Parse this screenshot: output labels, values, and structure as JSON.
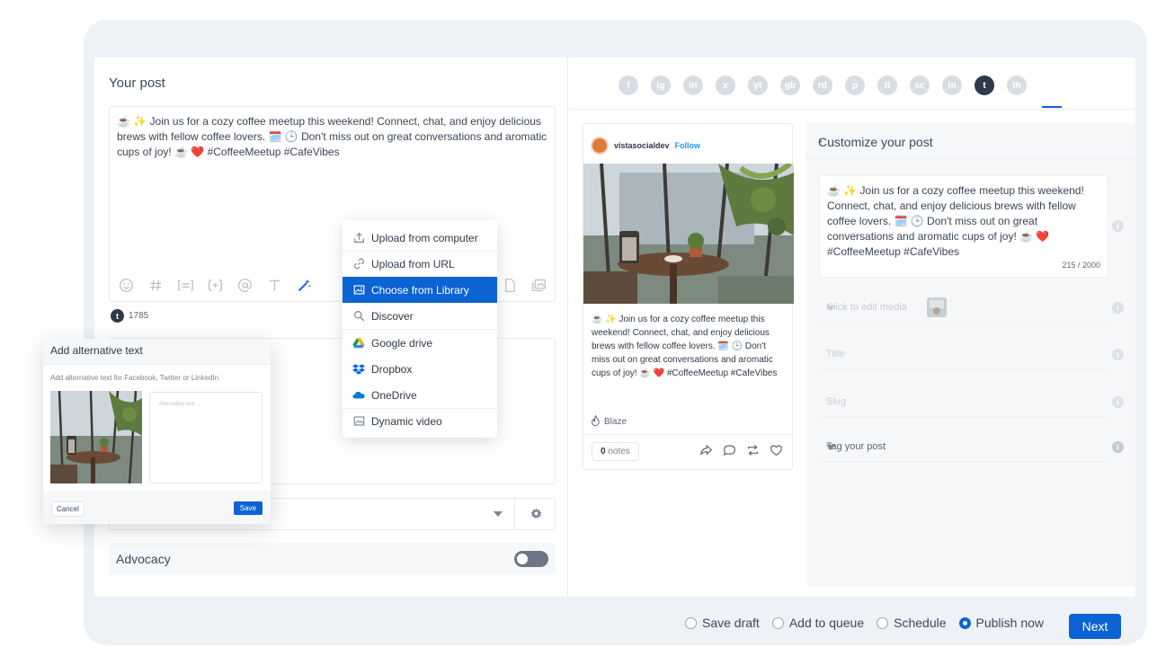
{
  "composer": {
    "title": "Your post",
    "text": "☕ ✨ Join us for a cozy coffee meetup this weekend! Connect, chat, and enjoy delicious brews with fellow coffee lovers. 🗓️ 🕒 Don't miss out on great conversations and aromatic cups of joy! ☕ ❤️ #CoffeeMeetup #CafeVibes",
    "char_count": "1785",
    "tumblr_letter": "t"
  },
  "advocacy": {
    "label": "Advocacy",
    "enabled": false
  },
  "networks": [
    "f",
    "ig",
    "in",
    "x",
    "yt",
    "gb",
    "rd",
    "p",
    "tt",
    "sc",
    "tn",
    "t",
    "th"
  ],
  "preview": {
    "account": "vistasocialdev",
    "follow": "Follow",
    "text": "☕ ✨ Join us for a cozy coffee meetup this weekend! Connect, chat, and enjoy delicious brews with fellow coffee lovers. 🗓️ 🕒 Don't miss out on great conversations and aromatic cups of joy! ☕ ❤️ #CoffeeMeetup #CafeVibes",
    "blaze": "Blaze",
    "notes_count": "0",
    "notes_label": "notes"
  },
  "customize": {
    "title": "Customize your post",
    "text": "☕ ✨ Join us for a cozy coffee meetup this weekend! Connect, chat, and enjoy delicious brews with fellow coffee lovers. 🗓️ 🕒 Don't miss out on great conversations and aromatic cups of joy! ☕ ❤️ #CoffeeMeetup #CafeVibes",
    "count": "215 / 2000",
    "media_placeholder": "Click to edit media",
    "title_placeholder": "Title",
    "slug_placeholder": "Slug",
    "tag_placeholder": "Tag your post"
  },
  "upload_menu": {
    "items": [
      {
        "label": "Upload from computer",
        "icon": "upload-icon"
      },
      {
        "label": "Upload from URL",
        "icon": "link-icon"
      },
      {
        "label": "Choose from Library",
        "icon": "image-icon"
      },
      {
        "label": "Discover",
        "icon": "search-icon"
      },
      {
        "label": "Google drive",
        "icon": "google-drive-icon"
      },
      {
        "label": "Dropbox",
        "icon": "dropbox-icon"
      },
      {
        "label": "OneDrive",
        "icon": "onedrive-icon"
      },
      {
        "label": "Dynamic video",
        "icon": "video-icon"
      }
    ],
    "highlighted": "Choose from Library"
  },
  "alt_modal": {
    "title": "Add alternative text",
    "subtitle": "Add alternative text for Facebook, Twitter or LinkedIn",
    "placeholder": "Alternative text ....",
    "cancel": "Cancel",
    "save": "Save"
  },
  "footer": {
    "options": [
      {
        "label": "Save draft",
        "selected": false
      },
      {
        "label": "Add to queue",
        "selected": false
      },
      {
        "label": "Schedule",
        "selected": false
      },
      {
        "label": "Publish now",
        "selected": true
      }
    ],
    "next": "Next"
  },
  "colors": {
    "accent": "#0b63d4",
    "follow": "#1e9bf0",
    "heart": "#e53935"
  }
}
